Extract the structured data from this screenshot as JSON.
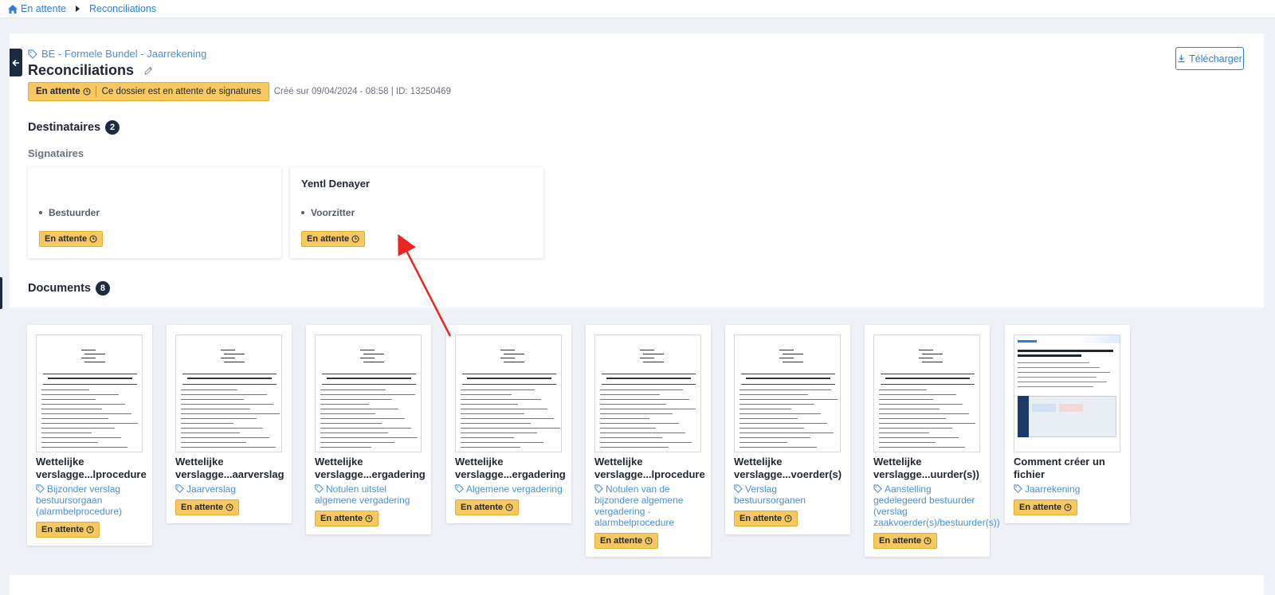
{
  "breadcrumb": {
    "home": "En attente",
    "current": "Reconciliations"
  },
  "header": {
    "tag": "BE - Formele Bundel - Jaarrekening",
    "title": "Reconciliations",
    "status": "En attente",
    "status_message": "Ce dossier est en attente de signatures",
    "meta": "Créé sur 09/04/2024 - 08:58 | ID: 13250469",
    "download_label": "Télécharger"
  },
  "recipients": {
    "heading": "Destinataires",
    "count": "2",
    "subheading": "Signataires",
    "cards": [
      {
        "name": "",
        "role": "Bestuurder",
        "status": "En attente"
      },
      {
        "name": "Yentl Denayer",
        "role": "Voorzitter",
        "status": "En attente"
      }
    ]
  },
  "documents": {
    "heading": "Documents",
    "count": "8",
    "items": [
      {
        "title": "Wettelijke verslagge...lprocedure",
        "tag": "Bijzonder verslag bestuursorgaan (alarmbelprocedure)",
        "status": "En attente"
      },
      {
        "title": "Wettelijke verslagge...aarverslag",
        "tag": "Jaarverslag",
        "status": "En attente"
      },
      {
        "title": "Wettelijke verslagge...ergadering",
        "tag": "Notulen uitstel algemene vergadering",
        "status": "En attente"
      },
      {
        "title": "Wettelijke verslagge...ergadering",
        "tag": "Algemene vergadering",
        "status": "En attente"
      },
      {
        "title": "Wettelijke verslagge...lprocedure",
        "tag": "Notulen van de bijzondere algemene vergadering - alarmbelprocedure",
        "status": "En attente"
      },
      {
        "title": "Wettelijke verslagge...voerder(s)",
        "tag": "Verslag bestuursorganen",
        "status": "En attente"
      },
      {
        "title": "Wettelijke verslagge...uurder(s))",
        "tag": "Aanstelling gedelegeerd bestuurder (verslag zaakvoerder(s)/bestuurder(s))",
        "status": "En attente"
      },
      {
        "title": "Comment créer un fichier",
        "tag": "Jaarrekening",
        "status": "En attente"
      }
    ]
  },
  "colors": {
    "accent": "#2f7fd8",
    "pending": "#f6c85f",
    "dark": "#1c2b3d",
    "arrow": "#e8281e"
  }
}
